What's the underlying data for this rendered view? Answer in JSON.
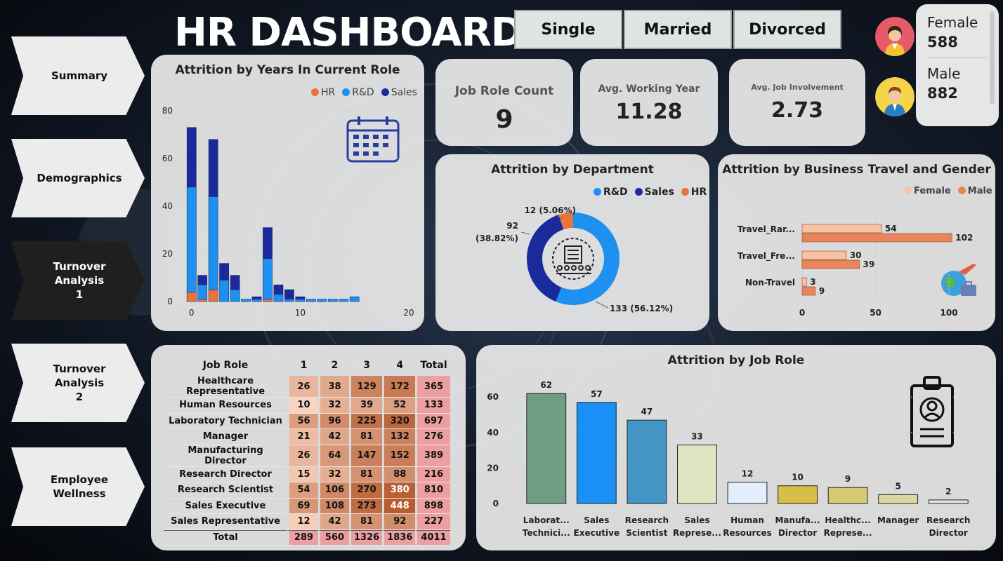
{
  "title": "HR DASHBOARD",
  "nav": [
    {
      "label_1": "Summary",
      "label_2": "",
      "active": false
    },
    {
      "label_1": "Demographics",
      "label_2": "",
      "active": false
    },
    {
      "label_1": "Turnover Analysis",
      "label_2": "1",
      "active": true
    },
    {
      "label_1": "Turnover Analysis",
      "label_2": "2",
      "active": false
    },
    {
      "label_1": "Employee Wellness",
      "label_2": "",
      "active": false
    }
  ],
  "slicers": [
    "Single",
    "Married",
    "Divorced"
  ],
  "gender": {
    "female_label": "Female",
    "female_value": "588",
    "male_label": "Male",
    "male_value": "882"
  },
  "kpis": {
    "job_role_count": {
      "label": "Job Role Count",
      "value": "9"
    },
    "avg_working_year": {
      "label": "Avg. Working Year",
      "value": "11.28"
    },
    "avg_job_involvement": {
      "label": "Avg. Job Involvement",
      "value": "2.73"
    }
  },
  "colors": {
    "hr": "#e8743b",
    "rd": "#1e90f0",
    "sales": "#1b2a9a",
    "female": "#f6c3a7",
    "male": "#e8855c"
  },
  "years_chart": {
    "title": "Attrition by Years In Current Role",
    "legend": [
      "HR",
      "R&D",
      "Sales"
    ],
    "chart_data": {
      "type": "bar",
      "x": [
        0,
        1,
        2,
        3,
        4,
        5,
        6,
        7,
        8,
        9,
        10,
        11,
        12,
        13,
        14,
        15
      ],
      "series": [
        {
          "name": "HR",
          "values": [
            4,
            1,
            5,
            0,
            0,
            0,
            0,
            1,
            0,
            0,
            0,
            0,
            0,
            0,
            0,
            0
          ]
        },
        {
          "name": "R&D",
          "values": [
            44,
            6,
            39,
            9,
            5,
            1,
            1,
            17,
            3,
            1,
            1,
            1,
            1,
            1,
            1,
            2
          ]
        },
        {
          "name": "Sales",
          "values": [
            25,
            4,
            24,
            7,
            6,
            0,
            1,
            13,
            4,
            4,
            1,
            0,
            0,
            0,
            0,
            0
          ]
        }
      ],
      "yticks": [
        0,
        20,
        40,
        60,
        80
      ],
      "xticks": [
        0,
        10,
        20
      ],
      "ylim": [
        0,
        80
      ],
      "xlim": [
        -0.5,
        20
      ]
    }
  },
  "department_chart": {
    "title": "Attrition by Department",
    "legend": [
      "R&D",
      "Sales",
      "HR"
    ],
    "chart_data": {
      "type": "pie",
      "categories": [
        "R&D",
        "Sales",
        "HR"
      ],
      "values": [
        133,
        92,
        12
      ],
      "percents": [
        "56.12%",
        "38.82%",
        "5.06%"
      ]
    },
    "label_rd": "133 (56.12%)",
    "label_sales_1": "92",
    "label_sales_2": "(38.82%)",
    "label_hr": "12 (5.06%)"
  },
  "travel_chart": {
    "title": "Attrition by Business Travel and Gender",
    "legend": [
      "Female",
      "Male"
    ],
    "chart_data": {
      "type": "bar",
      "orientation": "horizontal",
      "categories": [
        "Travel_Rar...",
        "Travel_Fre...",
        "Non-Travel"
      ],
      "series": [
        {
          "name": "Female",
          "values": [
            54,
            30,
            3
          ]
        },
        {
          "name": "Male",
          "values": [
            102,
            39,
            9
          ]
        }
      ],
      "xticks": [
        0,
        50,
        100
      ],
      "xlim": [
        0,
        110
      ]
    }
  },
  "matrix": {
    "headers": [
      "Job Role",
      "1",
      "2",
      "3",
      "4",
      "Total"
    ],
    "rows": [
      [
        "Healthcare Representative",
        "26",
        "38",
        "129",
        "172",
        "365"
      ],
      [
        "Human Resources",
        "10",
        "32",
        "39",
        "52",
        "133"
      ],
      [
        "Laboratory Technician",
        "56",
        "96",
        "225",
        "320",
        "697"
      ],
      [
        "Manager",
        "21",
        "42",
        "81",
        "132",
        "276"
      ],
      [
        "Manufacturing Director",
        "26",
        "64",
        "147",
        "152",
        "389"
      ],
      [
        "Research Director",
        "15",
        "32",
        "81",
        "88",
        "216"
      ],
      [
        "Research Scientist",
        "54",
        "106",
        "270",
        "380",
        "810"
      ],
      [
        "Sales Executive",
        "69",
        "108",
        "273",
        "448",
        "898"
      ],
      [
        "Sales Representative",
        "12",
        "42",
        "81",
        "92",
        "227"
      ],
      [
        "Total",
        "289",
        "560",
        "1326",
        "1836",
        "4011"
      ]
    ]
  },
  "jobrole_chart": {
    "title": "Attrition by Job Role",
    "chart_data": {
      "type": "bar",
      "categories": [
        "Laborat... Technici...",
        "Sales Executive",
        "Research Scientist",
        "Sales Represe...",
        "Human Resources",
        "Manufa... Director",
        "Healthc... Represe...",
        "Manager",
        "Research Director"
      ],
      "label_lines": [
        [
          "Laborat...",
          "Technici..."
        ],
        [
          "Sales",
          "Executive"
        ],
        [
          "Research",
          "Scientist"
        ],
        [
          "Sales",
          "Represe..."
        ],
        [
          "Human",
          "Resources"
        ],
        [
          "Manufa...",
          "Director"
        ],
        [
          "Healthc...",
          "Represe..."
        ],
        [
          "Manager",
          ""
        ],
        [
          "Research",
          "Director"
        ]
      ],
      "values": [
        62,
        57,
        47,
        33,
        12,
        10,
        9,
        5,
        2
      ],
      "colors": [
        "#6f9f83",
        "#1a8ff5",
        "#4295c5",
        "#dfe5c1",
        "#e2eefc",
        "#d8bd47",
        "#d7c872",
        "#dcd7a2",
        "#e3e4d6"
      ],
      "yticks": [
        0,
        20,
        40,
        60
      ],
      "ylim": [
        0,
        68
      ]
    }
  }
}
